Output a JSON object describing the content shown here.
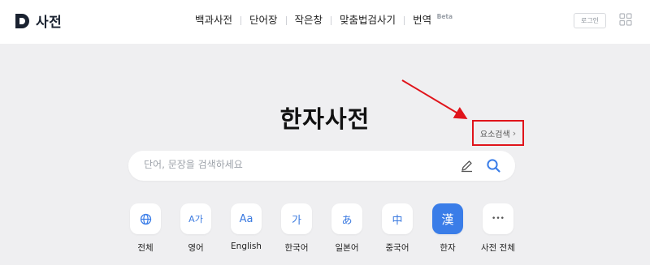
{
  "header": {
    "logo_text": "사전",
    "nav": [
      {
        "label": "백과사전"
      },
      {
        "label": "단어장"
      },
      {
        "label": "작은창"
      },
      {
        "label": "맞춤법검사기"
      },
      {
        "label": "번역",
        "badge": "Beta"
      }
    ],
    "login_label": "로그인"
  },
  "main": {
    "title": "한자사전",
    "element_search_label": "요소검색",
    "search_placeholder": "단어, 문장을 검색하세요"
  },
  "categories": [
    {
      "label": "전체",
      "icon": "globe-icon",
      "glyph": ""
    },
    {
      "label": "영어",
      "icon": "english-icon",
      "glyph": "A가"
    },
    {
      "label": "English",
      "icon": "aa-icon",
      "glyph": "Aa"
    },
    {
      "label": "한국어",
      "icon": "korean-icon",
      "glyph": "가"
    },
    {
      "label": "일본어",
      "icon": "japanese-icon",
      "glyph": "あ"
    },
    {
      "label": "중국어",
      "icon": "chinese-icon",
      "glyph": "中"
    },
    {
      "label": "한자",
      "icon": "hanja-icon",
      "glyph": "漢",
      "active": true
    },
    {
      "label": "사전 전체",
      "icon": "more-icon",
      "glyph": "•••"
    }
  ],
  "colors": {
    "accent": "#3a7de8",
    "highlight_box": "#e0141b",
    "background": "#efeff1"
  }
}
